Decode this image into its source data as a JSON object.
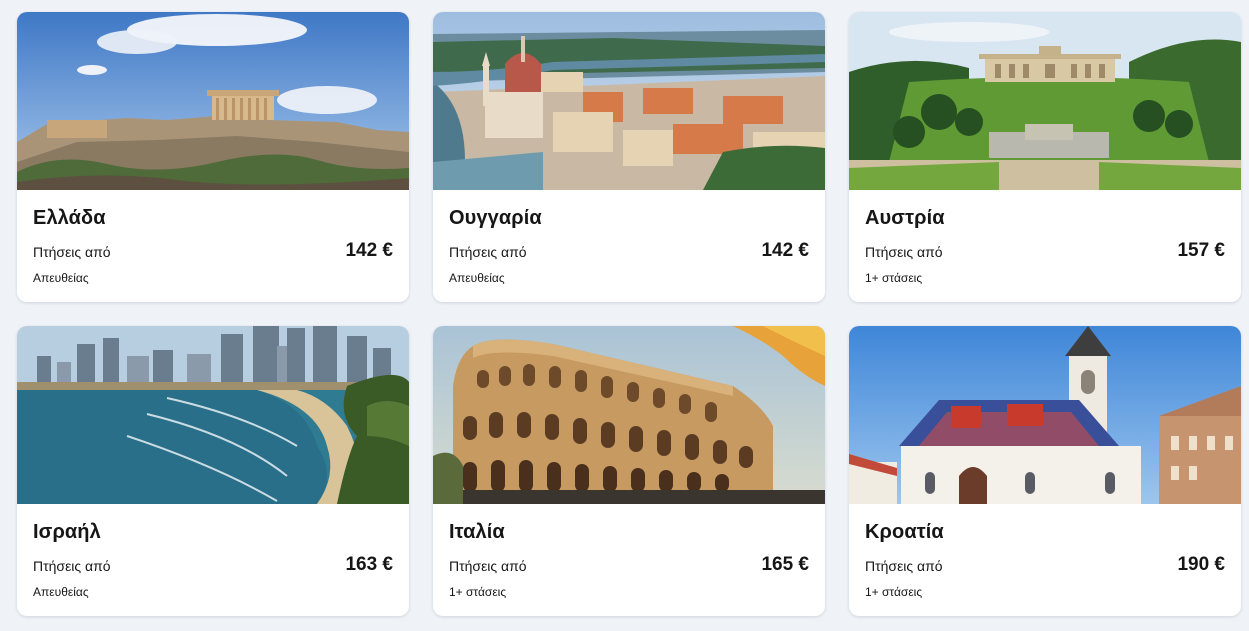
{
  "destinations": [
    {
      "name": "Ελλάδα",
      "from_label": "Πτήσεις από",
      "price": "142 €",
      "stops": "Απευθείας",
      "image_icon": "acropolis-photo"
    },
    {
      "name": "Ουγγαρία",
      "from_label": "Πτήσεις από",
      "price": "142 €",
      "stops": "Απευθείας",
      "image_icon": "budapest-parliament-photo"
    },
    {
      "name": "Αυστρία",
      "from_label": "Πτήσεις από",
      "price": "157 €",
      "stops": "1+ στάσεις",
      "image_icon": "schonbrunn-gloriette-photo"
    },
    {
      "name": "Ισραήλ",
      "from_label": "Πτήσεις από",
      "price": "163 €",
      "stops": "Απευθείας",
      "image_icon": "tel-aviv-beach-photo"
    },
    {
      "name": "Ιταλία",
      "from_label": "Πτήσεις από",
      "price": "165 €",
      "stops": "1+ στάσεις",
      "image_icon": "colosseum-photo"
    },
    {
      "name": "Κροατία",
      "from_label": "Πτήσεις από",
      "price": "190 €",
      "stops": "1+ στάσεις",
      "image_icon": "zagreb-st-mark-church-photo"
    }
  ]
}
